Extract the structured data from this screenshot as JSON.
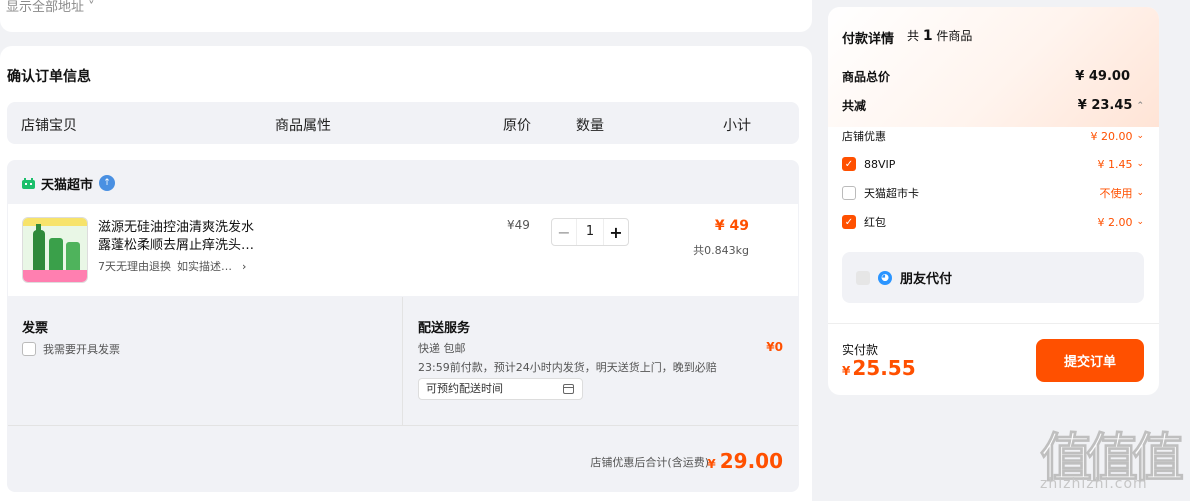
{
  "address": {
    "show_all": "显示全部地址"
  },
  "order": {
    "title": "确认订单信息",
    "columns": [
      "店铺宝贝",
      "商品属性",
      "原价",
      "数量",
      "小计"
    ],
    "shop": {
      "name": "天猫超市",
      "badge": "↑"
    },
    "item": {
      "title": "滋源无硅油控油清爽洗发水露蓬松柔顺去屑止痒洗头…",
      "tags": [
        "7天无理由退换",
        "如实描述…"
      ],
      "orig_price": "¥49",
      "quantity": "1",
      "subtotal": "¥ 49",
      "weight": "共0.843kg"
    },
    "invoice": {
      "title": "发票",
      "option": "我需要开具发票"
    },
    "delivery": {
      "title": "配送服务",
      "type": "快递 包邮",
      "desc": "23:59前付款，预计24小时内发货，明天送货上门，晚到必赔",
      "fee": "¥0",
      "time_placeholder": "可预约配送时间"
    },
    "shop_total_label": "店铺优惠后合计(含运费)",
    "shop_total_yen": "¥",
    "shop_total": "29.00"
  },
  "payment": {
    "title": "付款详情",
    "count_prefix": "共",
    "count": "1",
    "count_suffix": "件商品",
    "goods_total_label": "商品总价",
    "goods_total": "¥ 49.00",
    "discount_label": "共减",
    "discount": "¥ 23.45",
    "shop_coupon_label": "店铺优惠",
    "shop_coupon": "¥ 20.00",
    "vip_label": "88VIP",
    "vip": "¥ 1.45",
    "card_label": "天猫超市卡",
    "card": "不使用",
    "redpacket_label": "红包",
    "redpacket": "¥ 2.00",
    "friend_pay": "朋友代付",
    "actual_label": "实付款",
    "actual_yen": "¥",
    "actual": "25.55",
    "submit": "提交订单"
  },
  "watermark": {
    "glyphs": "值值值",
    "text": "zhizhizhi.com"
  },
  "colors": {
    "accent": "#ff5000",
    "panel": "#f1f2f6"
  }
}
